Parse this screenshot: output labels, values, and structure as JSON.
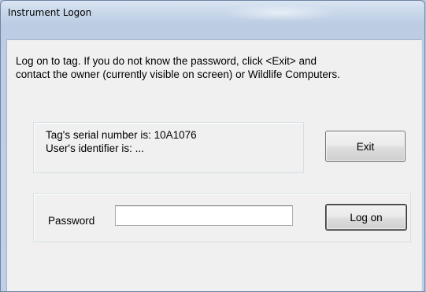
{
  "window": {
    "title": "Instrument Logon"
  },
  "message": {
    "line1": "Log on to tag.  If you do not know the password, click <Exit> and",
    "line2": "contact the owner (currently visible on screen) or Wildlife Computers."
  },
  "tag_info": {
    "serial_line": "Tag's serial number is:  10A1076",
    "user_line": "User's identifier is:  ..."
  },
  "buttons": {
    "exit_label": "Exit",
    "logon_label": "Log on"
  },
  "password": {
    "label": "Password",
    "value": ""
  }
}
